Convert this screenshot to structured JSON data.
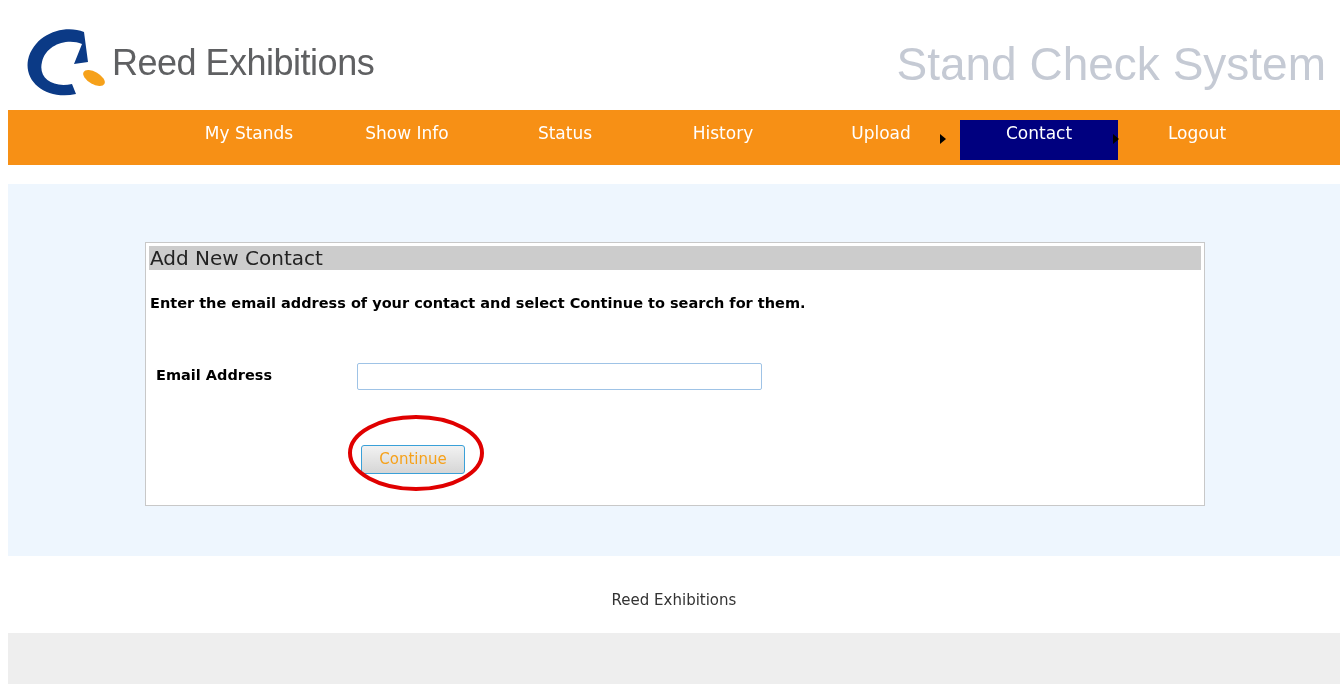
{
  "header": {
    "brand": "Reed Exhibitions",
    "system_title": "Stand Check System"
  },
  "nav": [
    {
      "label": "My Stands",
      "selected": false
    },
    {
      "label": "Show Info",
      "selected": false
    },
    {
      "label": "Status",
      "selected": false
    },
    {
      "label": "History",
      "selected": false
    },
    {
      "label": "Upload",
      "selected": false
    },
    {
      "label": "Contact",
      "selected": true
    },
    {
      "label": "Logout",
      "selected": false
    }
  ],
  "form": {
    "title": "Add New Contact",
    "instruction": "Enter the email address of your contact and select Continue to search for them.",
    "field_label": "Email Address",
    "button": {
      "label": "Continue",
      "circled": true
    }
  },
  "footer": {
    "text": "Reed Exhibitions"
  }
}
